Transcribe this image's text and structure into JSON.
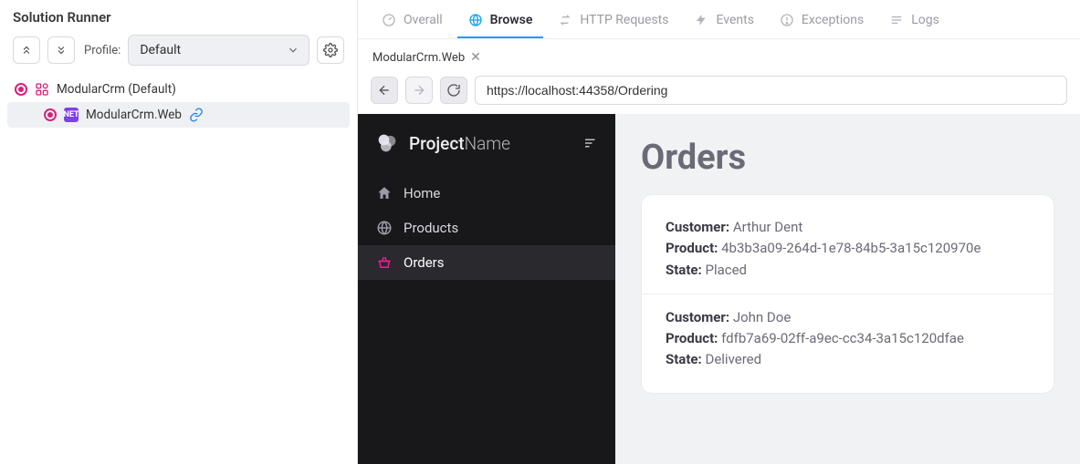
{
  "left": {
    "title": "Solution Runner",
    "profile_label": "Profile:",
    "profile_selected": "Default",
    "tree": {
      "root_label": "ModularCrm (Default)",
      "child_label": "ModularCrm.Web"
    }
  },
  "tabs": [
    {
      "id": "overall",
      "label": "Overall",
      "icon": "gauge"
    },
    {
      "id": "browse",
      "label": "Browse",
      "icon": "globe",
      "active": true
    },
    {
      "id": "http",
      "label": "HTTP Requests",
      "icon": "swap"
    },
    {
      "id": "events",
      "label": "Events",
      "icon": "bolt"
    },
    {
      "id": "exceptions",
      "label": "Exceptions",
      "icon": "alert"
    },
    {
      "id": "logs",
      "label": "Logs",
      "icon": "lines"
    }
  ],
  "subtab": {
    "label": "ModularCrm.Web"
  },
  "address": {
    "url": "https://localhost:44358/Ordering"
  },
  "page": {
    "brand_main": "Project",
    "brand_sub": "Name",
    "nav": [
      {
        "id": "home",
        "label": "Home",
        "icon": "home"
      },
      {
        "id": "products",
        "label": "Products",
        "icon": "globe"
      },
      {
        "id": "orders",
        "label": "Orders",
        "icon": "basket",
        "active": true
      }
    ],
    "heading": "Orders",
    "labels": {
      "customer": "Customer:",
      "product": "Product:",
      "state": "State:"
    },
    "orders": [
      {
        "customer": "Arthur Dent",
        "product": "4b3b3a09-264d-1e78-84b5-3a15c120970e",
        "state": "Placed"
      },
      {
        "customer": "John Doe",
        "product": "fdfb7a69-02ff-a9ec-cc34-3a15c120dfae",
        "state": "Delivered"
      }
    ]
  }
}
